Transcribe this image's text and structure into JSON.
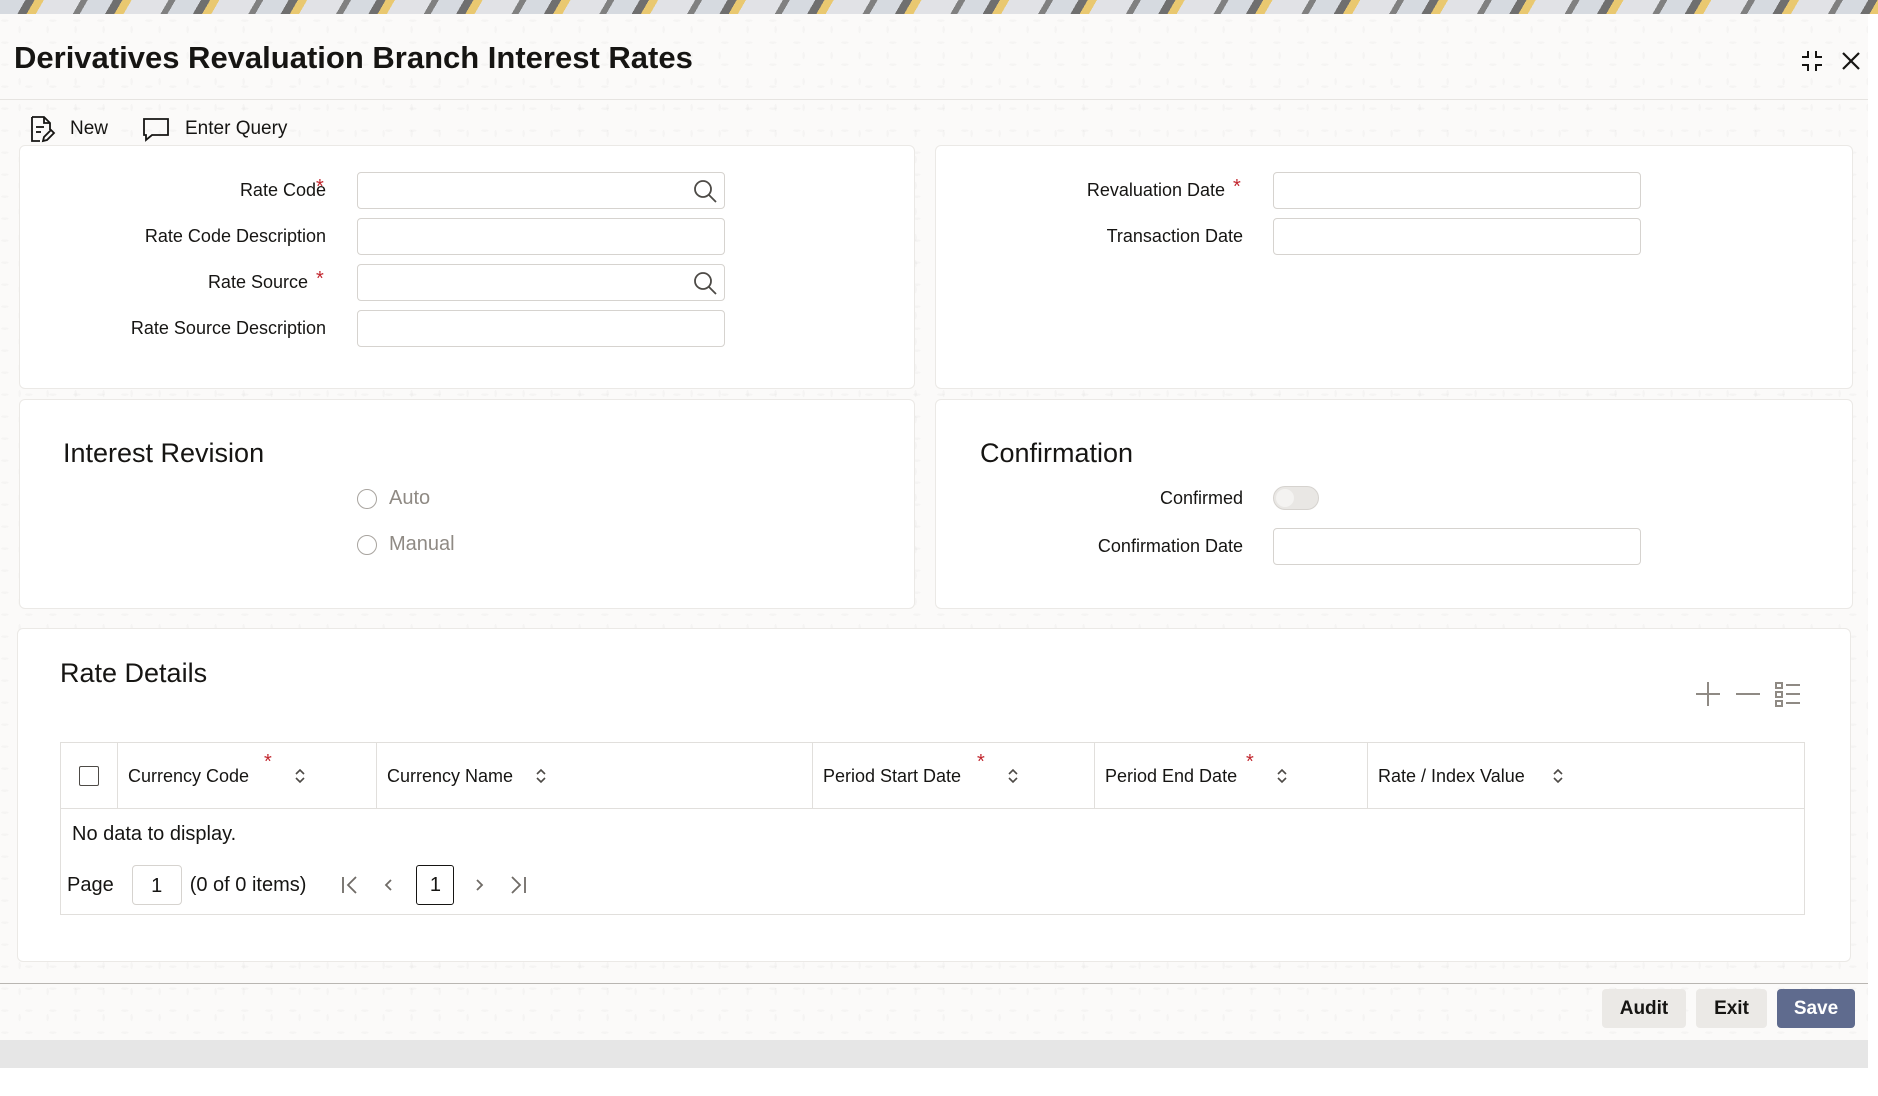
{
  "window": {
    "title": "Derivatives Revaluation Branch Interest Rates"
  },
  "toolbar": {
    "new_label": "New",
    "enter_query_label": "Enter Query"
  },
  "rate_panel": {
    "rate_code_label": "Rate Code",
    "rate_code_desc_label": "Rate Code Description",
    "rate_source_label": "Rate Source",
    "rate_source_desc_label": "Rate Source Description",
    "rate_code_value": "",
    "rate_code_desc_value": "",
    "rate_source_value": "",
    "rate_source_desc_value": ""
  },
  "date_panel": {
    "revaluation_date_label": "Revaluation Date",
    "transaction_date_label": "Transaction Date",
    "revaluation_date_value": "",
    "transaction_date_value": ""
  },
  "required_marker": "*",
  "interest_revision": {
    "title": "Interest Revision",
    "options": [
      "Auto",
      "Manual"
    ]
  },
  "confirmation": {
    "title": "Confirmation",
    "confirmed_label": "Confirmed",
    "confirmed": false,
    "confirmation_date_label": "Confirmation Date",
    "confirmation_date_value": ""
  },
  "rate_details": {
    "title": "Rate Details",
    "columns": [
      "Currency Code",
      "Currency Name",
      "Period Start Date",
      "Period End Date",
      "Rate / Index Value"
    ],
    "rows": [],
    "empty_text": "No data to display.",
    "pagination": {
      "page_label": "Page",
      "page_input": "1",
      "items_summary": "(0 of 0 items)",
      "current_page": "1"
    }
  },
  "footer": {
    "audit_label": "Audit",
    "exit_label": "Exit",
    "save_label": "Save"
  },
  "colors": {
    "primary_button": "#5f6b8e",
    "required": "#c2262e",
    "panel_border": "#ebe9e6"
  }
}
